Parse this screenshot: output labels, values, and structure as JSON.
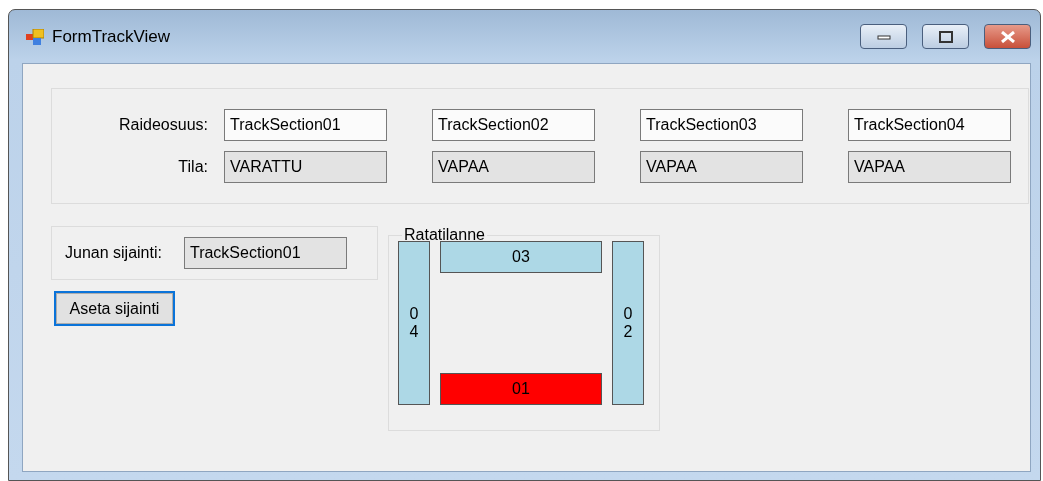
{
  "window": {
    "title": "FormTrackView"
  },
  "sections": {
    "section_label": "Raideosuus:",
    "state_label": "Tila:",
    "columns": [
      {
        "section": "TrackSection01",
        "state": "VARATTU"
      },
      {
        "section": "TrackSection02",
        "state": "VAPAA"
      },
      {
        "section": "TrackSection03",
        "state": "VAPAA"
      },
      {
        "section": "TrackSection04",
        "state": "VAPAA"
      }
    ]
  },
  "location": {
    "label": "Junan sijainti:",
    "value": "TrackSection01"
  },
  "button": "Aseta sijainti",
  "track": {
    "title": "Ratatilanne",
    "pieces": [
      {
        "label": "04",
        "kind": "left",
        "occupied": false
      },
      {
        "label": "03",
        "kind": "top",
        "occupied": false
      },
      {
        "label": "02",
        "kind": "right",
        "occupied": false
      },
      {
        "label": "01",
        "kind": "bottom",
        "occupied": true
      }
    ]
  }
}
